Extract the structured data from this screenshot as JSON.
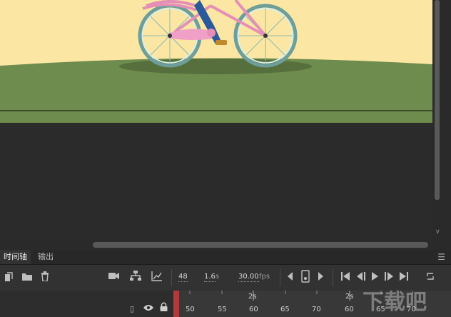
{
  "timeline": {
    "tabs": [
      {
        "label": "时间轴"
      },
      {
        "label": "输出"
      }
    ],
    "current_frame": "48",
    "elapsed": "1.6",
    "elapsed_unit": "s",
    "fps": "30.00",
    "fps_unit": "fps",
    "ruler": {
      "frame_labels": [
        "50",
        "55",
        "60",
        "65",
        "70",
        "60",
        "65",
        "70"
      ],
      "second_labels": [
        "2s",
        "2s"
      ]
    }
  },
  "icons": {
    "new_layer": "new-layer-icon",
    "new_folder": "folder-icon",
    "delete": "trash-icon",
    "camera": "camera-icon",
    "hierarchy": "hierarchy-icon",
    "graph": "graph-icon",
    "eye": "eye-icon",
    "lock": "lock-icon"
  },
  "stage": {
    "sky_color": "#fbe7a3",
    "ground_color": "#6e8c4e",
    "pasteboard_color": "#2b2b2b"
  },
  "watermark": "下载吧"
}
